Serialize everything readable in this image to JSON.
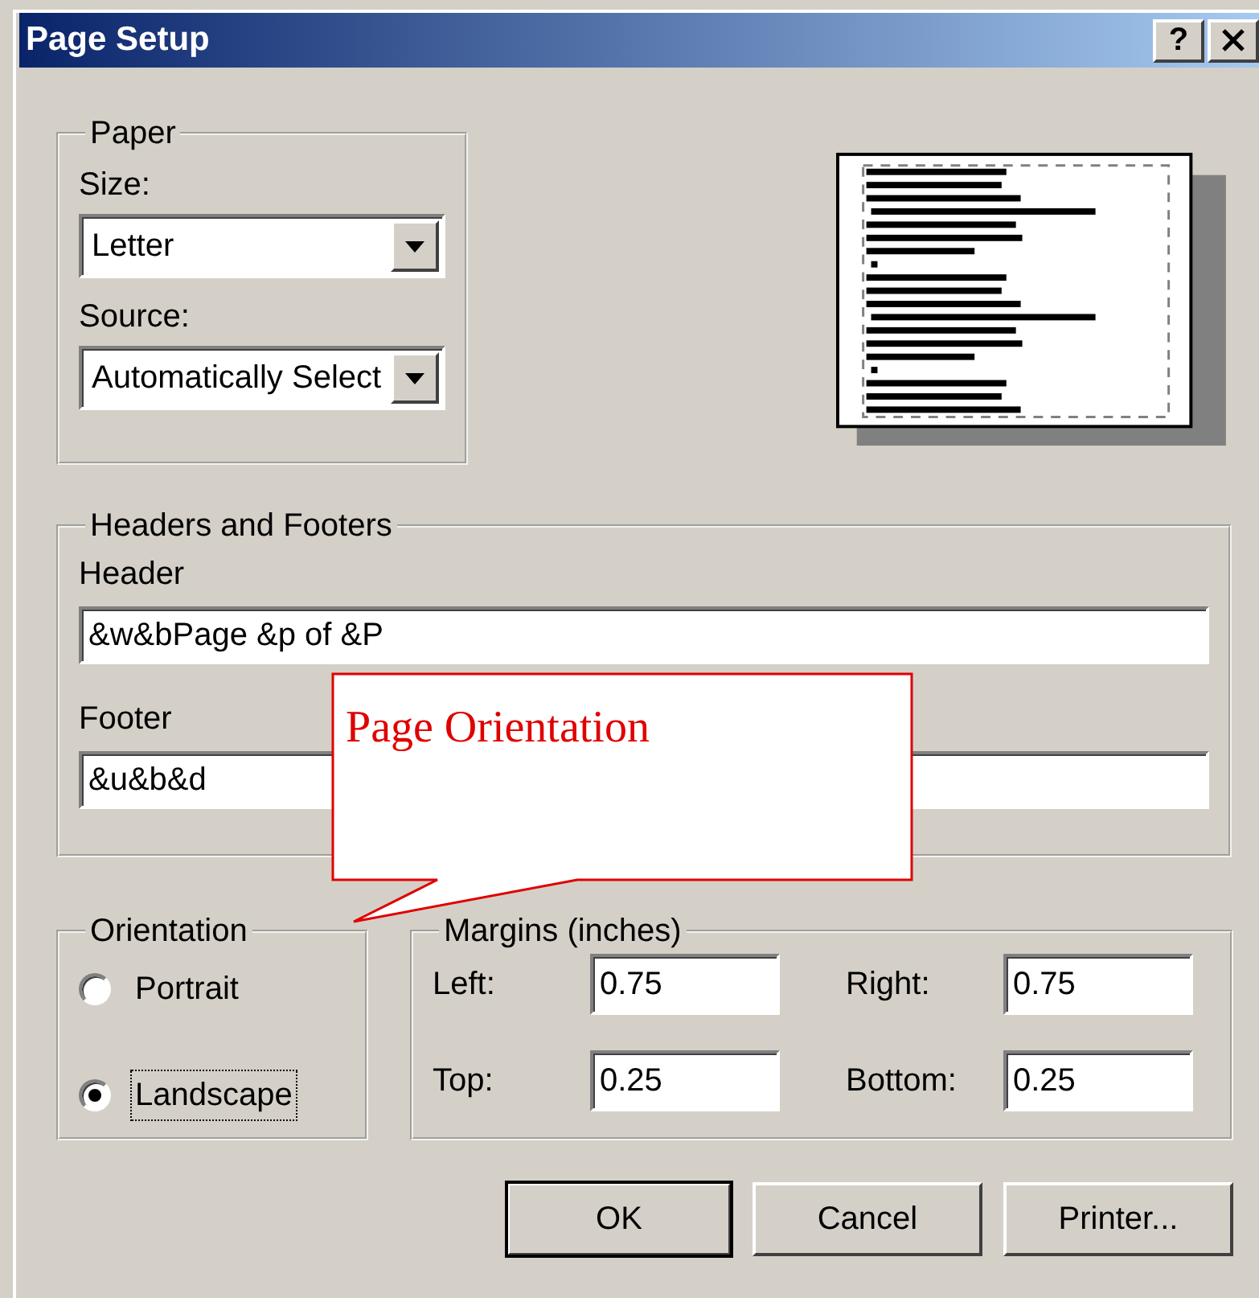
{
  "window": {
    "title": "Page Setup",
    "help": "?"
  },
  "paper": {
    "legend": "Paper",
    "fields": [
      {
        "label": "Size:",
        "value": "Letter"
      },
      {
        "label": "Source:",
        "value": "Automatically Select"
      }
    ]
  },
  "headers_footers": {
    "legend": "Headers and Footers",
    "fields": [
      {
        "label": "Header",
        "value": "&w&bPage &p of &P"
      },
      {
        "label": "Footer",
        "value": "&u&b&d"
      }
    ]
  },
  "orientation": {
    "legend": "Orientation",
    "options": [
      {
        "label": "Portrait",
        "selected": false,
        "focused": false
      },
      {
        "label": "Landscape",
        "selected": true,
        "focused": true
      }
    ]
  },
  "margins": {
    "legend": "Margins (inches)",
    "fields": [
      {
        "label": "Left:",
        "value": "0.75"
      },
      {
        "label": "Right:",
        "value": "0.75"
      },
      {
        "label": "Top:",
        "value": "0.25"
      },
      {
        "label": "Bottom:",
        "value": "0.25"
      }
    ]
  },
  "buttons": [
    {
      "label": "OK",
      "default": true
    },
    {
      "label": "Cancel",
      "default": false
    },
    {
      "label": "Printer...",
      "default": false
    }
  ],
  "callout": {
    "text": "Page Orientation"
  }
}
